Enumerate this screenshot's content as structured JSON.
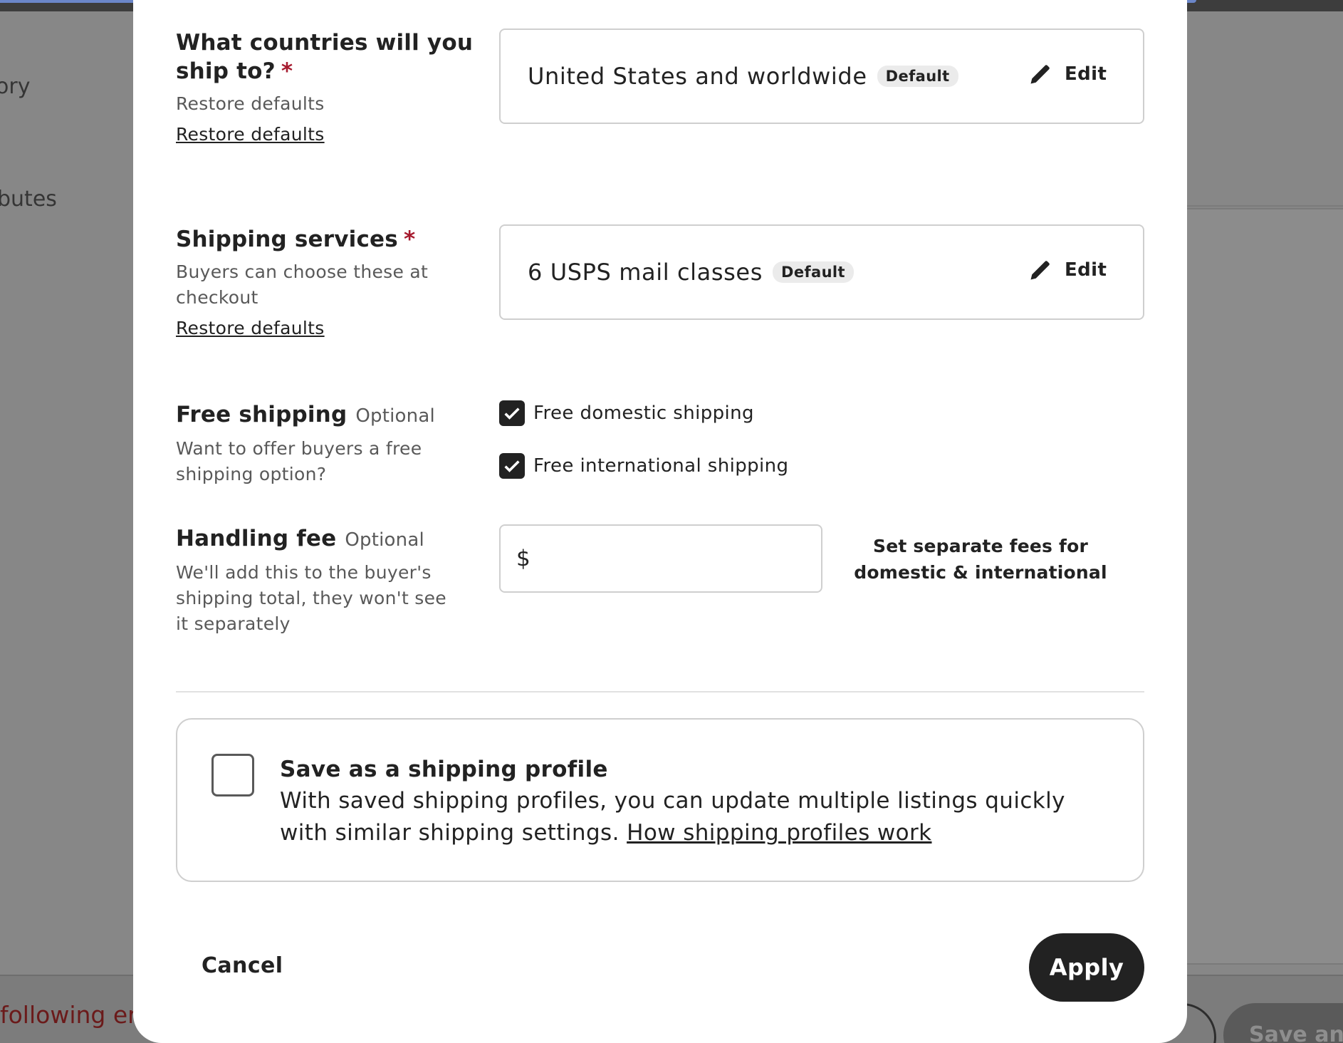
{
  "background": {
    "left_text_1": "ory",
    "left_text_2": "butes",
    "error_text": "following err",
    "save_button_label": "Save and"
  },
  "countries": {
    "title": "What countries will you ship to?",
    "required_mark": "*",
    "description": "Restore defaults",
    "restore_link": "Restore defaults",
    "value": "United States and worldwide",
    "badge": "Default",
    "edit_label": "Edit"
  },
  "services": {
    "title": "Shipping services",
    "required_mark": "*",
    "description": "Buyers can choose these at checkout",
    "restore_link": "Restore defaults",
    "value": "6 USPS mail classes",
    "badge": "Default",
    "edit_label": "Edit"
  },
  "free_shipping": {
    "title": "Free shipping",
    "optional": "Optional",
    "description": "Want to offer buyers a free shipping option?",
    "options": [
      {
        "label": "Free domestic shipping",
        "checked": true
      },
      {
        "label": "Free international shipping",
        "checked": true
      }
    ]
  },
  "handling_fee": {
    "title": "Handling fee",
    "optional": "Optional",
    "description": "We'll add this to the buyer's shipping total, they won't see it separately",
    "currency_prefix": "$",
    "value": "",
    "separate_fees_link": "Set separate fees for domestic & international"
  },
  "profile": {
    "title": "Save as a shipping profile",
    "description": "With saved shipping profiles, you can update multiple listings quickly with similar shipping settings.",
    "link": "How shipping profiles work",
    "checked": false
  },
  "footer": {
    "cancel_label": "Cancel",
    "apply_label": "Apply"
  },
  "colors": {
    "primary": "#222222",
    "required": "#a61a2e",
    "muted": "#595959",
    "border": "#cfcfcf"
  }
}
